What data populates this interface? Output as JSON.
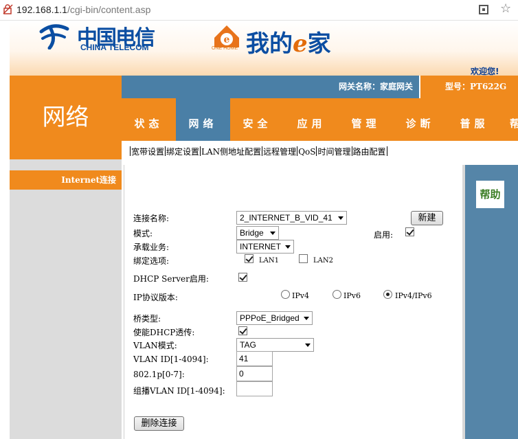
{
  "browser": {
    "url_host": "192.168.1.1",
    "url_path": "/cgi-bin/content.asp"
  },
  "banner": {
    "ct_logo_cn": "中国电信",
    "ct_logo_en": "CHINA TELECOM",
    "onehome_small": "ONE HOME",
    "brand_prefix": "我的",
    "brand_e": "e",
    "brand_suffix": "家",
    "welcome": "欢迎您!"
  },
  "header": {
    "page_title": "网络",
    "gateway_name": "网关名称：家庭网关",
    "model": "型号：PT622G"
  },
  "nav": {
    "items": [
      {
        "label": "状态",
        "active": false
      },
      {
        "label": "网络",
        "active": true
      },
      {
        "label": "安全",
        "active": false
      },
      {
        "label": "应用",
        "active": false
      },
      {
        "label": "管理",
        "active": false
      },
      {
        "label": "诊断",
        "active": false
      },
      {
        "label": "普服",
        "active": false
      },
      {
        "label": "帮助",
        "active": false
      }
    ],
    "subnav": [
      "宽带设置",
      "绑定设置",
      "LAN侧地址配置",
      "远程管理",
      "QoS",
      "时间管理",
      "路由配置"
    ]
  },
  "sidebar": {
    "items": [
      {
        "label": "Internet连接"
      }
    ]
  },
  "help_panel": {
    "title": "帮助"
  },
  "form": {
    "connection_name_label": "连接名称:",
    "connection_name_value": "2_INTERNET_B_VID_41",
    "new_button": "新建",
    "mode_label": "模式:",
    "mode_value": "Bridge",
    "enable_label": "启用:",
    "enable_checked": true,
    "service_label": "承载业务:",
    "service_value": "INTERNET",
    "bind_label": "绑定选项:",
    "bind_options": [
      {
        "label": "LAN1",
        "checked": true
      },
      {
        "label": "LAN2",
        "checked": false
      }
    ],
    "dhcp_server_label": "DHCP Server启用:",
    "dhcp_server_checked": true,
    "ip_version_label": "IP协议版本:",
    "ip_versions": [
      {
        "label": "IPv4",
        "checked": false
      },
      {
        "label": "IPv6",
        "checked": false
      },
      {
        "label": "IPv4/IPv6",
        "checked": true
      }
    ],
    "bridge_type_label": "桥类型:",
    "bridge_type_value": "PPPoE_Bridged",
    "dhcp_passthrough_label": "使能DHCP透传:",
    "dhcp_passthrough_checked": true,
    "vlan_mode_label": "VLAN模式:",
    "vlan_mode_value": "TAG",
    "vlan_id_label": "VLAN ID[1-4094]:",
    "vlan_id_value": "41",
    "dot1p_label": "802.1p[0-7]:",
    "dot1p_value": "0",
    "mcast_vlan_label": "组播VLAN ID[1-4094]:",
    "mcast_vlan_value": "",
    "delete_button": "删除连接"
  },
  "colors": {
    "orange": "#f08a1d",
    "steel_blue": "#4a7fa6",
    "brand_blue": "#0b4ea2",
    "help_green": "#3a7d23"
  }
}
